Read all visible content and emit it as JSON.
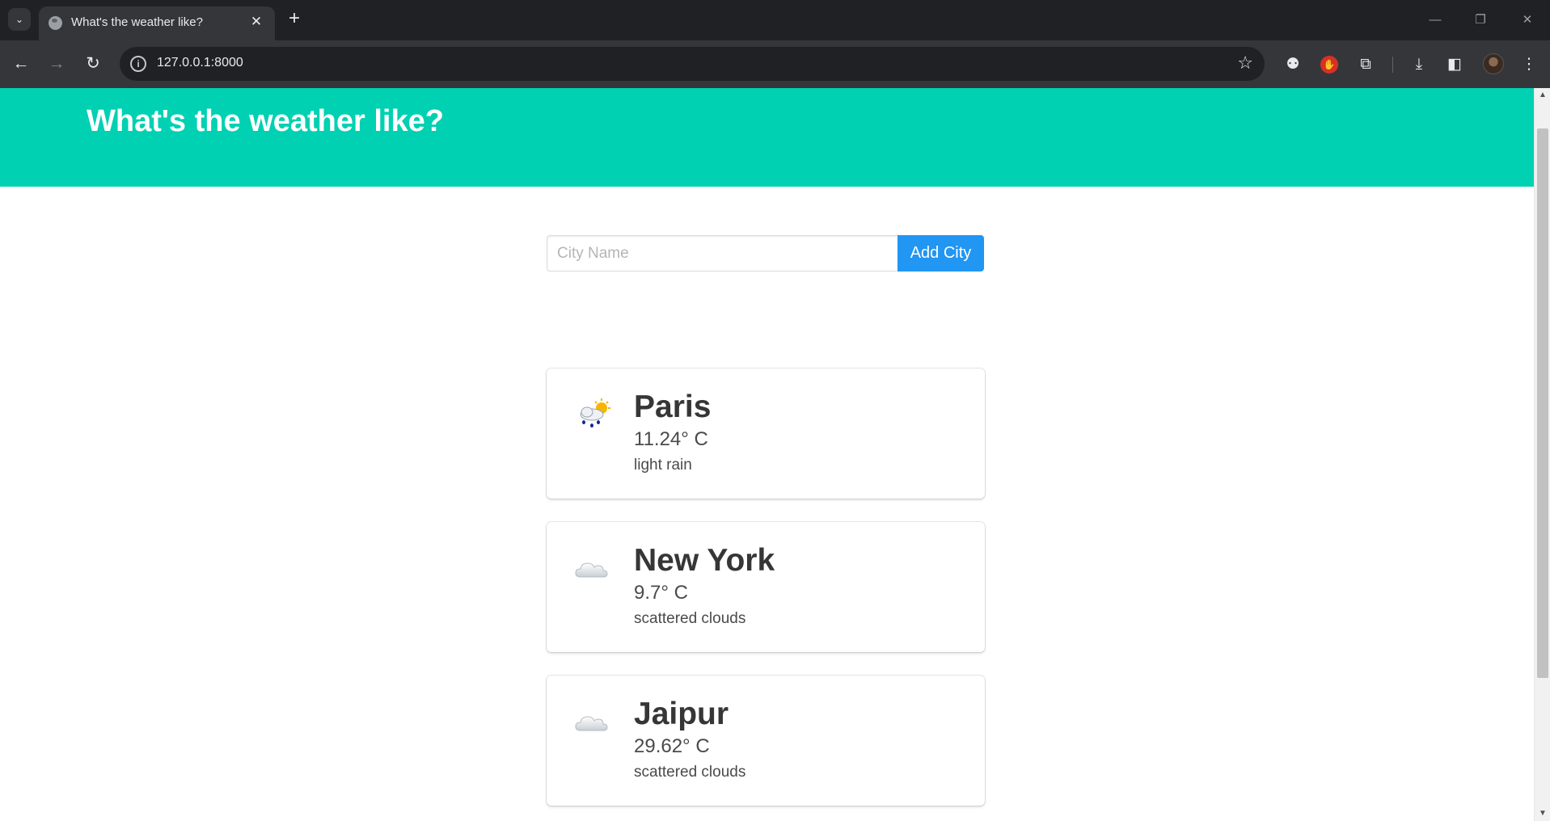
{
  "browser": {
    "tab_title": "What's the weather like?",
    "tab_close": "✕",
    "new_tab": "+",
    "url": "127.0.0.1:8000"
  },
  "page": {
    "title": "What's the weather like?",
    "search": {
      "placeholder": "City Name",
      "value": ""
    },
    "add_button_label": "Add City"
  },
  "cities": [
    {
      "name": "Paris",
      "temperature": "11.24° C",
      "description": "light rain",
      "icon": "rain-sun-icon"
    },
    {
      "name": "New York",
      "temperature": "9.7° C",
      "description": "scattered clouds",
      "icon": "cloud-icon"
    },
    {
      "name": "Jaipur",
      "temperature": "29.62° C",
      "description": "scattered clouds",
      "icon": "cloud-icon"
    }
  ],
  "colors": {
    "hero": "#00d1b2",
    "button": "#2196f3",
    "browser_dark": "#202124",
    "browser_toolbar": "#35363a"
  }
}
